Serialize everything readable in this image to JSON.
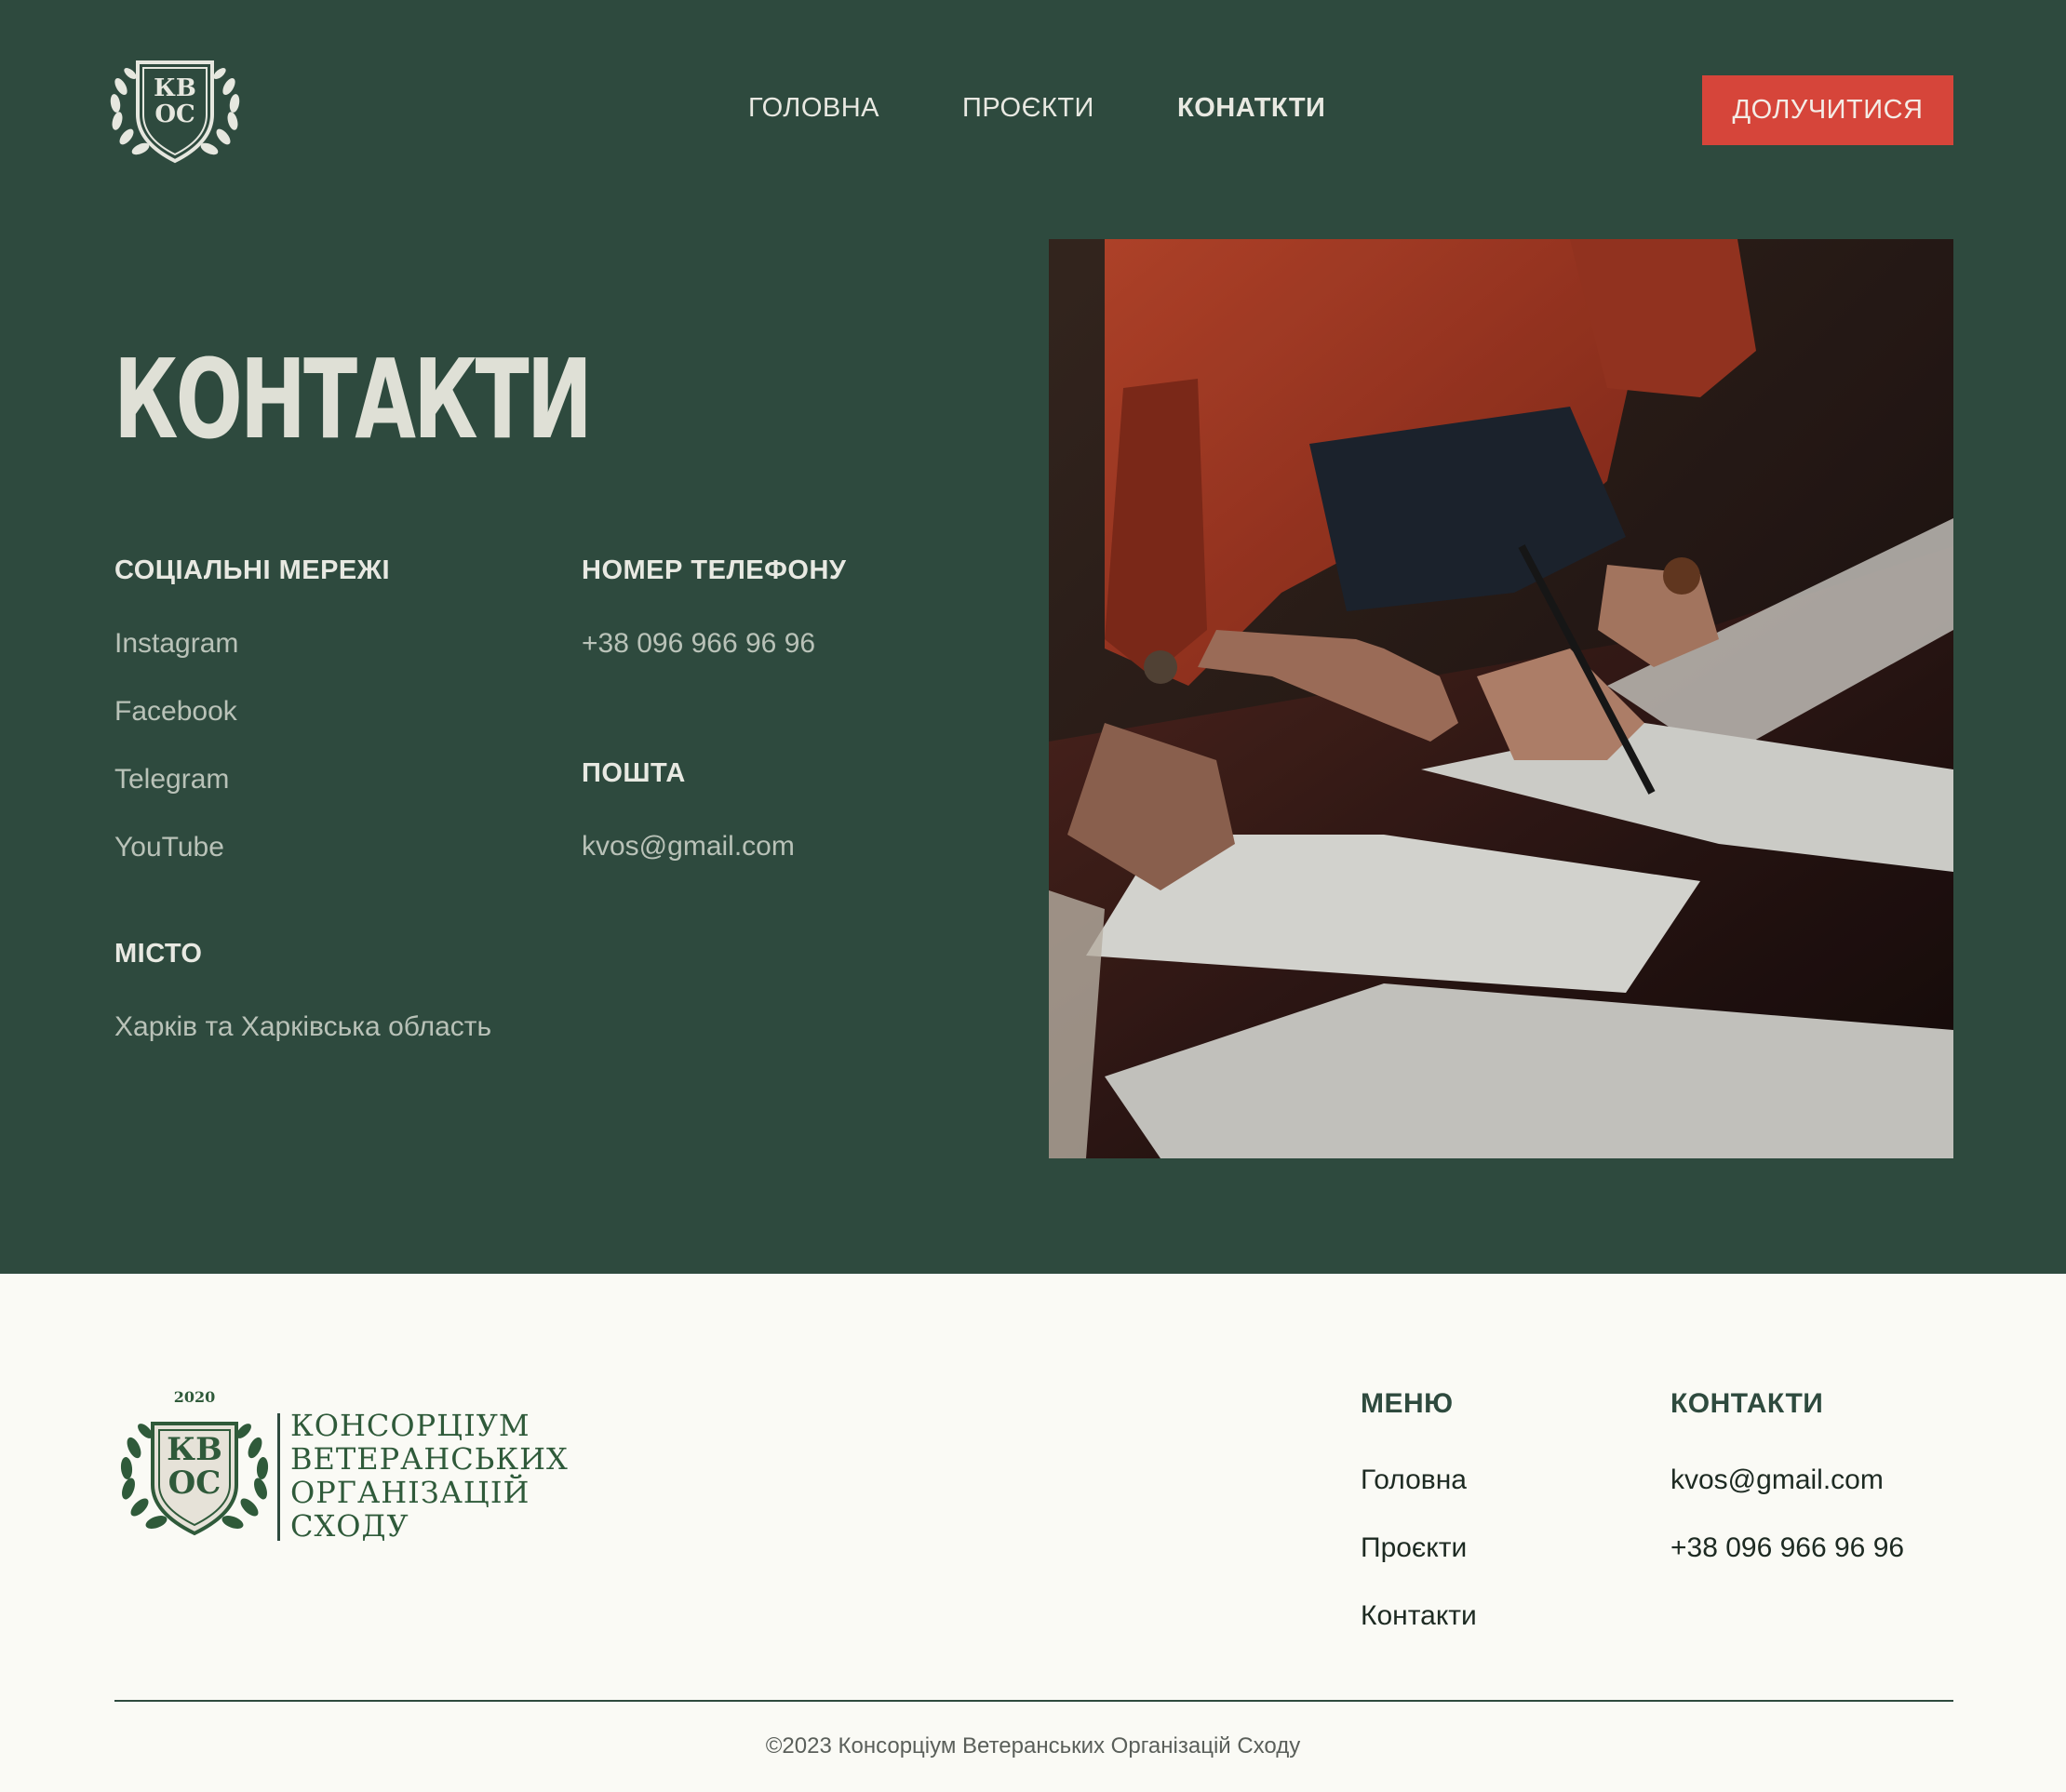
{
  "header": {
    "logo_text": [
      "КВ",
      "ОС"
    ],
    "nav": [
      {
        "label": "ГОЛОВНА",
        "active": false
      },
      {
        "label": "ПРОЄКТИ",
        "active": false
      },
      {
        "label": "КОНАТКТИ",
        "active": true
      }
    ],
    "join_button": "ДОЛУЧИТИСЯ"
  },
  "contacts": {
    "title": "КОНТАКТИ",
    "social": {
      "label": "СОЦІАЛЬНІ МЕРЕЖІ",
      "items": [
        "Instagram",
        "Facebook",
        "Telegram",
        "YouTube"
      ]
    },
    "phone": {
      "label": "НОМЕР ТЕЛЕФОНУ",
      "value": "+38 096 966 96 96"
    },
    "email": {
      "label": "ПОШТА",
      "value": "kvos@gmail.com"
    },
    "city": {
      "label": "МІСТО",
      "value": "Харків та Харківська область"
    }
  },
  "footer": {
    "logo_year": "2020",
    "logo_text": [
      "КВ",
      "ОС"
    ],
    "org_name": [
      "КОНСОРЦІУМ",
      "ВЕТЕРАНСЬКИХ",
      "ОРГАНІЗАЦІЙ",
      "СХОДУ"
    ],
    "menu": {
      "heading": "МЕНЮ",
      "items": [
        "Головна",
        "Проєкти",
        "Контакти"
      ]
    },
    "contacts": {
      "heading": "КОНТАКТИ",
      "email": "kvos@gmail.com",
      "phone": "+38 096 966 96 96"
    },
    "copyright": "©2023 Консорціум Ветеранських Організацій Сходу"
  },
  "colors": {
    "primary_green": "#2e4a3e",
    "accent_red": "#d6453a",
    "footer_bg": "#fafaf5"
  }
}
